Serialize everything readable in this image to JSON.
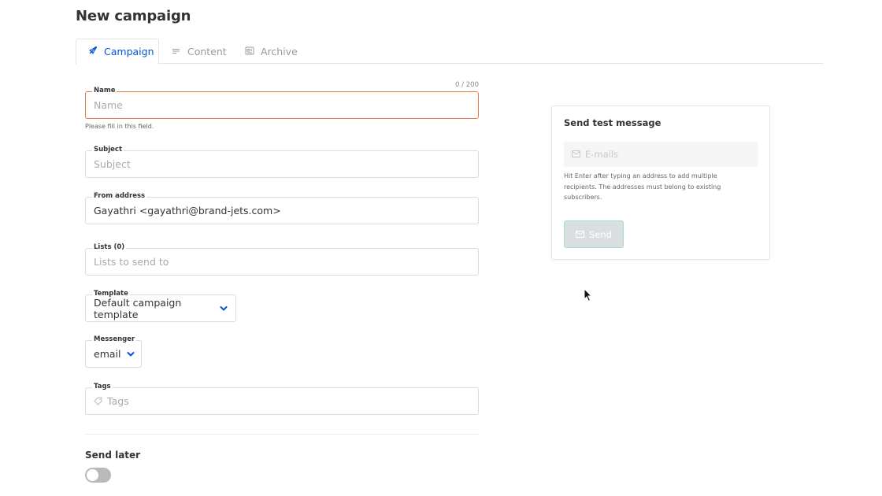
{
  "page": {
    "title": "New campaign"
  },
  "tabs": [
    {
      "label": "Campaign",
      "icon": "rocket-icon",
      "active": true
    },
    {
      "label": "Content",
      "icon": "align-left-icon",
      "active": false
    },
    {
      "label": "Archive",
      "icon": "newspaper-icon",
      "active": false
    }
  ],
  "form": {
    "name": {
      "label": "Name",
      "placeholder": "Name",
      "value": "",
      "counter": "0 / 200",
      "error": "Please fill in this field."
    },
    "subject": {
      "label": "Subject",
      "placeholder": "Subject",
      "value": ""
    },
    "from_address": {
      "label": "From address",
      "value": "Gayathri <gayathri@brand-jets.com>"
    },
    "lists": {
      "label": "Lists (0)",
      "placeholder": "Lists to send to"
    },
    "template": {
      "label": "Template",
      "selected": "Default campaign template"
    },
    "messenger": {
      "label": "Messenger",
      "selected": "email"
    },
    "tags": {
      "label": "Tags",
      "placeholder": "Tags",
      "icon": "tag-icon"
    },
    "send_later": {
      "label": "Send later",
      "enabled": false
    }
  },
  "test_panel": {
    "title": "Send test message",
    "emails_placeholder": "E-mails",
    "help": "Hit Enter after typing an address to add multiple recipients. The addresses must belong to existing subscribers.",
    "send_label": "Send"
  },
  "colors": {
    "accent": "#0055d4",
    "error_border": "#e87a44",
    "send_button_border": "#a8dcd3"
  }
}
